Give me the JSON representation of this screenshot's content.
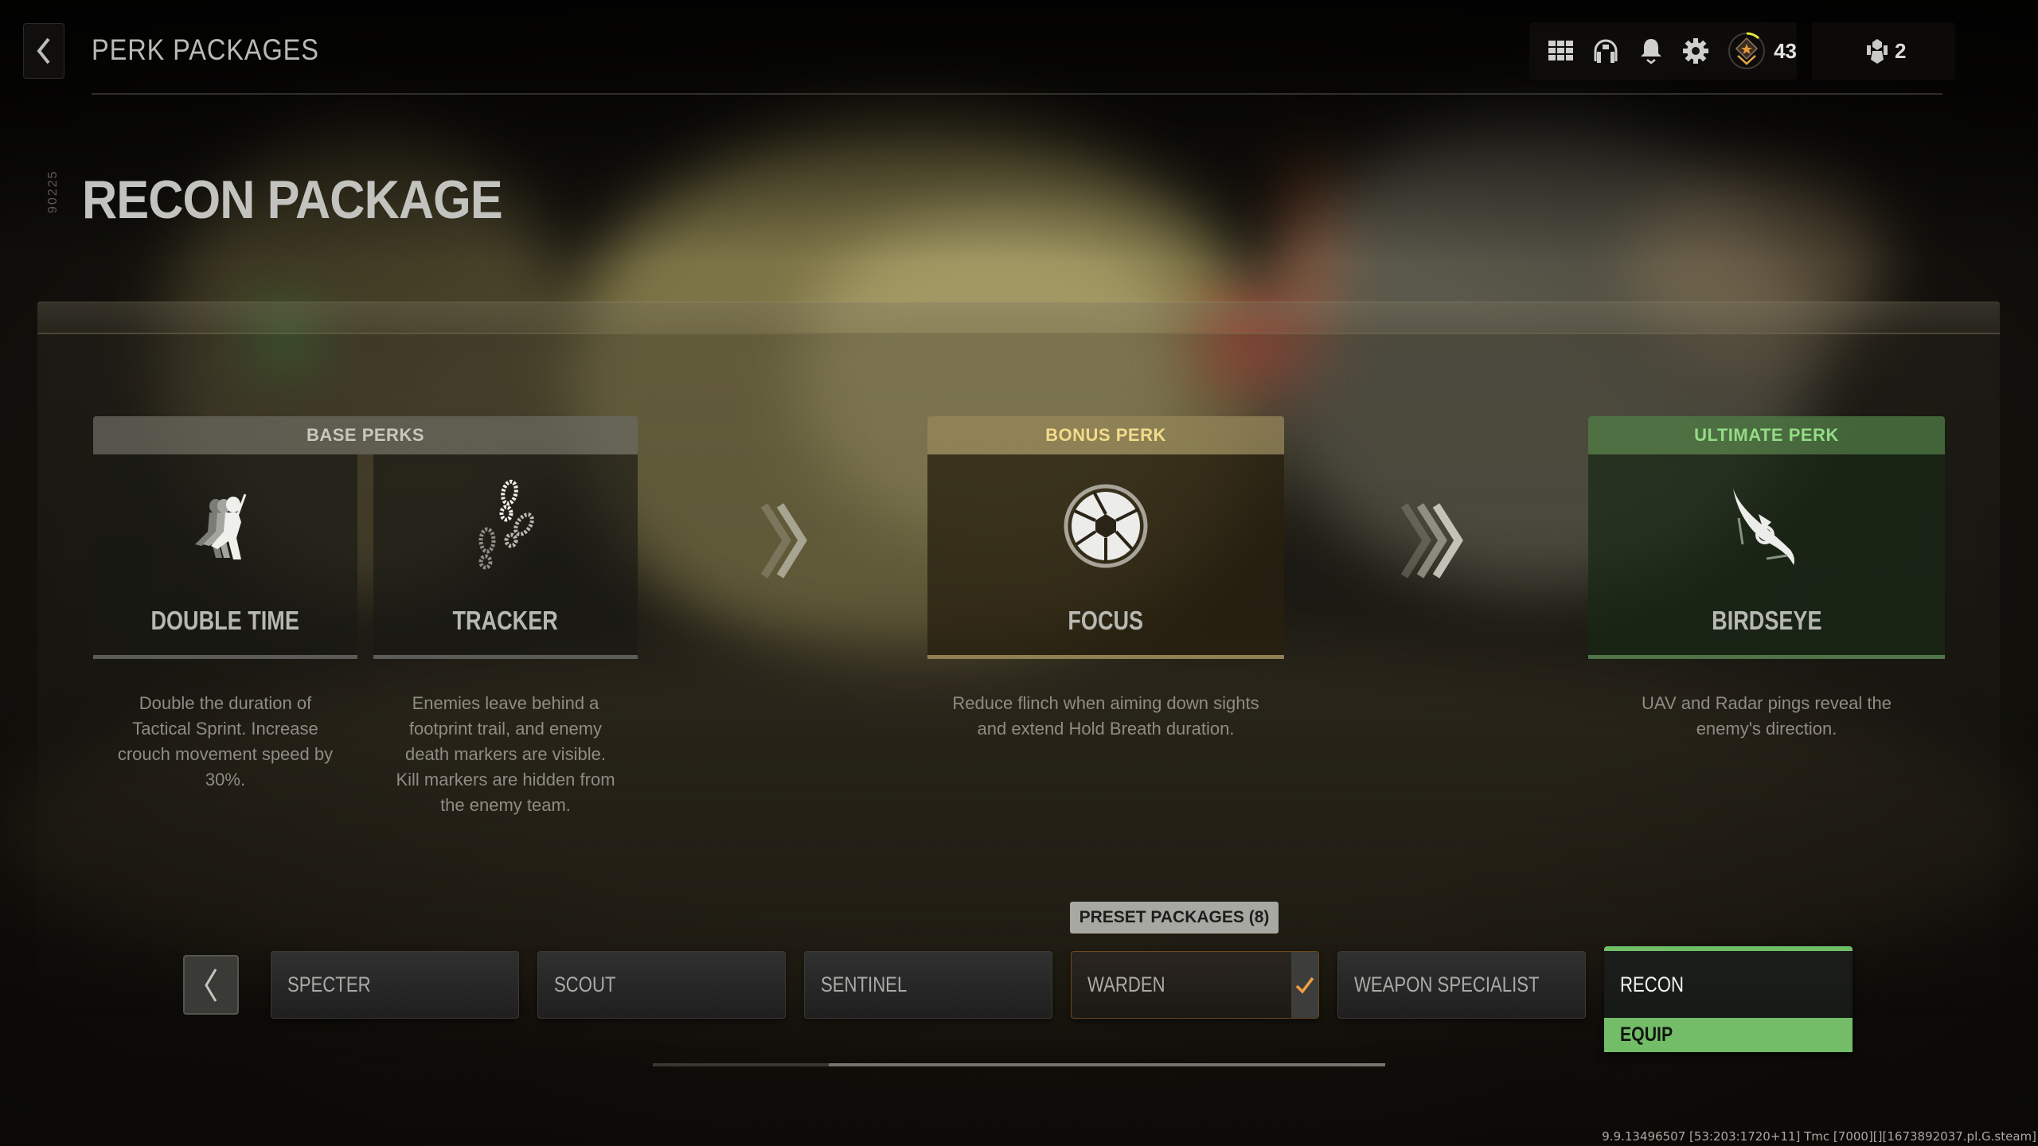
{
  "header": {
    "back_label": "Back",
    "title": "PERK PACKAGES",
    "toolbar": {
      "icons": [
        "grid-menu-icon",
        "headset-icon",
        "bell-icon",
        "gear-icon"
      ],
      "rank_level": "43",
      "rank_progress": 0.12,
      "party_count": "2"
    }
  },
  "package": {
    "id_code": "90225",
    "title": "RECON PACKAGE"
  },
  "perks": {
    "base": {
      "heading": "BASE PERKS",
      "items": [
        {
          "name": "DOUBLE TIME",
          "icon": "running-soldier-icon",
          "description_lines": [
            "Double the duration of",
            "Tactical Sprint. Increase",
            "crouch movement speed by",
            "30%."
          ]
        },
        {
          "name": "TRACKER",
          "icon": "footprints-icon",
          "description_lines": [
            "Enemies leave behind a",
            "footprint trail, and enemy",
            "death markers are visible.",
            "Kill markers are hidden from",
            "the enemy team."
          ]
        }
      ]
    },
    "bonus": {
      "heading": "BONUS PERK",
      "item": {
        "name": "FOCUS",
        "icon": "aperture-icon",
        "description_lines": [
          "Reduce flinch when aiming down sights",
          "and extend Hold Breath duration."
        ]
      }
    },
    "ultimate": {
      "heading": "ULTIMATE PERK",
      "item": {
        "name": "BIRDSEYE",
        "icon": "bird-eye-icon",
        "description_lines": [
          "UAV and Radar pings reveal the",
          "enemy's direction."
        ]
      }
    }
  },
  "presets": {
    "label": "PRESET PACKAGES (8)",
    "packages": [
      {
        "name": "SPECTER",
        "state": "default"
      },
      {
        "name": "SCOUT",
        "state": "default"
      },
      {
        "name": "SENTINEL",
        "state": "default"
      },
      {
        "name": "WARDEN",
        "state": "equipped"
      },
      {
        "name": "WEAPON SPECIALIST",
        "state": "default"
      },
      {
        "name": "RECON",
        "state": "selected"
      }
    ],
    "equip_label": "EQUIP",
    "scroll_position": {
      "start": 0.24,
      "end": 1.0
    }
  },
  "colors": {
    "bonus_accent": "#f3dc8a",
    "ultimate_accent": "#94dc86",
    "equip_green": "#73bd69",
    "equipped_check": "#f0a040",
    "rank_progress": "#e8e83a"
  },
  "build_info": "9.9.13496507 [53:203:1720+11] Tmc [7000][][1673892037.pl.G.steam]"
}
